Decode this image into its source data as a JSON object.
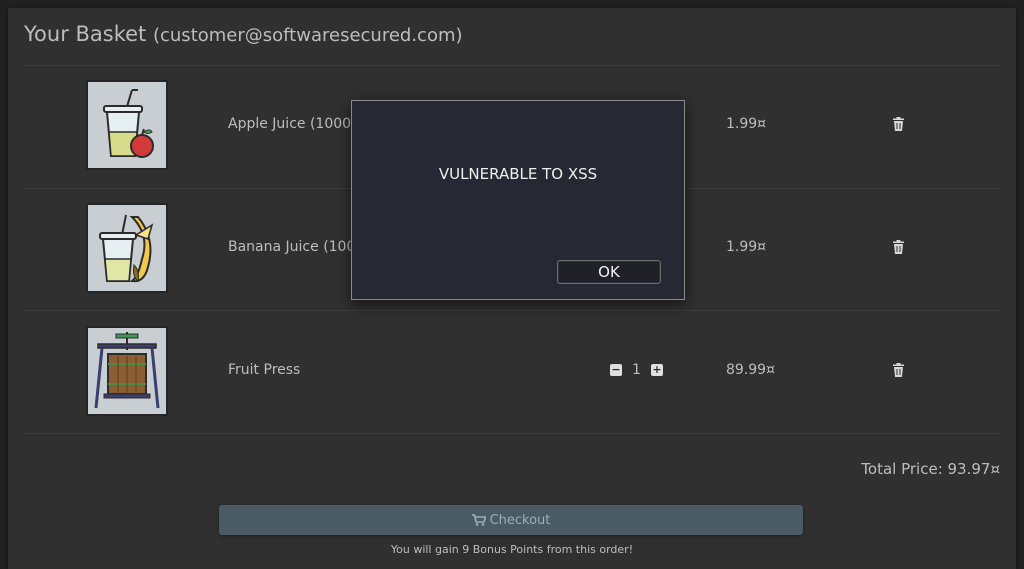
{
  "basket": {
    "title": "Your Basket",
    "email": "(customer@softwaresecured.com)",
    "items": [
      {
        "name": "Apple Juice (1000",
        "price": "1.99¤",
        "image_icon": "apple-juice-icon"
      },
      {
        "name": "Banana Juice (100",
        "price": "1.99¤",
        "image_icon": "banana-juice-icon"
      },
      {
        "name": "Fruit Press",
        "price": "89.99¤",
        "quantity": "1",
        "image_icon": "fruit-press-icon"
      }
    ],
    "total": "Total Price: 93.97¤",
    "checkout_label": "Checkout",
    "bonus_text": "You will gain 9 Bonus Points from this order!"
  },
  "dialog": {
    "message": "VULNERABLE TO XSS",
    "ok_label": "OK"
  },
  "colors": {
    "background": "#212121",
    "card": "#303030",
    "checkout_button": "#4b5b63",
    "dialog": "#262833"
  }
}
